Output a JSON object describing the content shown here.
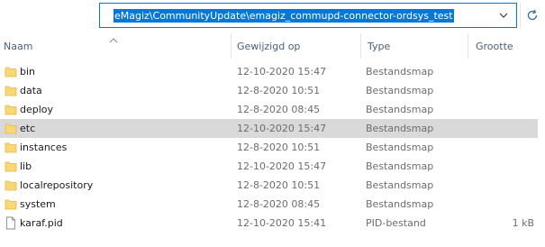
{
  "address": {
    "path": "eMagiz\\CommunityUpdate\\emagiz_commupd-connector-ordsys_test"
  },
  "columns": {
    "name": "Naam",
    "modified": "Gewijzigd op",
    "type": "Type",
    "size": "Grootte"
  },
  "files": [
    {
      "name": "bin",
      "modified": "12-10-2020 15:47",
      "type": "Bestandsmap",
      "size": "",
      "icon": "folder-icon"
    },
    {
      "name": "data",
      "modified": "12-8-2020 10:51",
      "type": "Bestandsmap",
      "size": "",
      "icon": "folder-icon"
    },
    {
      "name": "deploy",
      "modified": "12-8-2020 08:45",
      "type": "Bestandsmap",
      "size": "",
      "icon": "folder-icon"
    },
    {
      "name": "etc",
      "modified": "12-10-2020 15:47",
      "type": "Bestandsmap",
      "size": "",
      "icon": "folder-icon",
      "selected": true
    },
    {
      "name": "instances",
      "modified": "12-8-2020 10:51",
      "type": "Bestandsmap",
      "size": "",
      "icon": "folder-icon"
    },
    {
      "name": "lib",
      "modified": "12-10-2020 15:47",
      "type": "Bestandsmap",
      "size": "",
      "icon": "folder-icon"
    },
    {
      "name": "localrepository",
      "modified": "12-8-2020 10:51",
      "type": "Bestandsmap",
      "size": "",
      "icon": "folder-icon"
    },
    {
      "name": "system",
      "modified": "12-8-2020 08:45",
      "type": "Bestandsmap",
      "size": "",
      "icon": "folder-icon"
    },
    {
      "name": "karaf.pid",
      "modified": "12-10-2020 15:41",
      "type": "PID-bestand",
      "size": "1 kB",
      "icon": "file-icon"
    }
  ],
  "colors": {
    "accent": "#0078d7",
    "folder": "#f8d775",
    "selected_row": "#d9d9d9",
    "header_text": "#4c607a"
  }
}
